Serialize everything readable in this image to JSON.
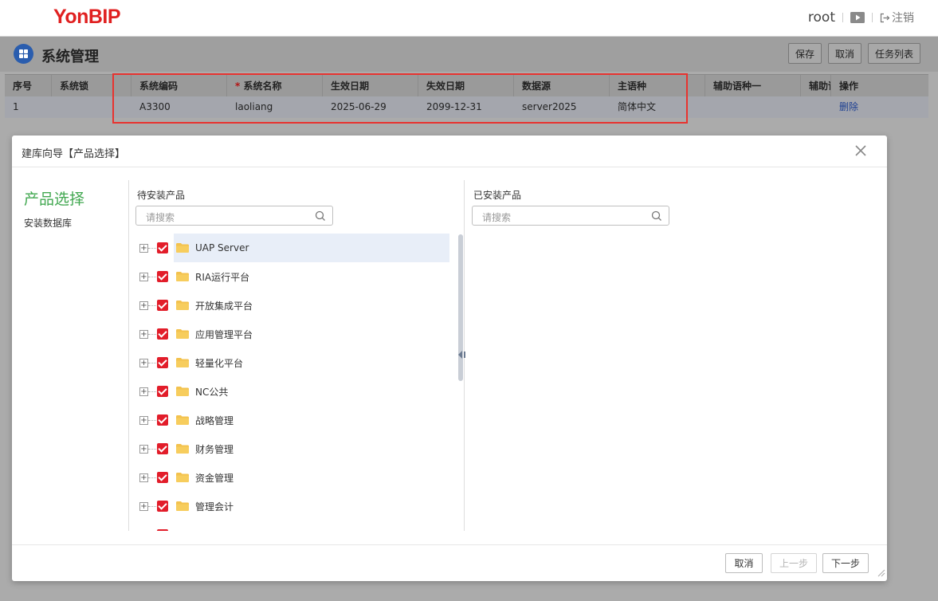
{
  "header": {
    "logo": "YonBIP",
    "user": "root",
    "logout_label": "注销"
  },
  "page": {
    "title": "系统管理",
    "buttons": {
      "save": "保存",
      "cancel": "取消",
      "task_list": "任务列表"
    }
  },
  "grid": {
    "columns": [
      "序号",
      "系统锁",
      "系统编码",
      "系统名称",
      "生效日期",
      "失效日期",
      "数据源",
      "主语种",
      "辅助语种一",
      "辅助语",
      "操作"
    ],
    "required_mark": "*",
    "rows": [
      {
        "index": "1",
        "lock": "",
        "code": "A3300",
        "name": "laoliang",
        "start": "2025-06-29",
        "end": "2099-12-31",
        "datasource": "server2025",
        "language": "简体中文",
        "aux1": "",
        "aux2": "",
        "action": "删除"
      }
    ]
  },
  "dialog": {
    "title": "建库向导【产品选择】",
    "steps": {
      "current": "产品选择",
      "next": "安装数据库"
    },
    "left_pane": {
      "label": "待安装产品",
      "search_placeholder": "请搜索",
      "items": [
        "UAP Server",
        "RIA运行平台",
        "开放集成平台",
        "应用管理平台",
        "轻量化平台",
        "NC公共",
        "战略管理",
        "财务管理",
        "资金管理",
        "管理会计"
      ],
      "selected_index": 0
    },
    "right_pane": {
      "label": "已安装产品",
      "search_placeholder": "请搜索"
    },
    "footer": {
      "cancel": "取消",
      "prev": "上一步",
      "next": "下一步"
    }
  },
  "colors": {
    "accent_green": "#42a851",
    "logo_red": "#e02020",
    "highlight_red": "#e8332f",
    "checkbox_red": "#e21d2a",
    "title_icon_blue": "#2a5dae"
  }
}
